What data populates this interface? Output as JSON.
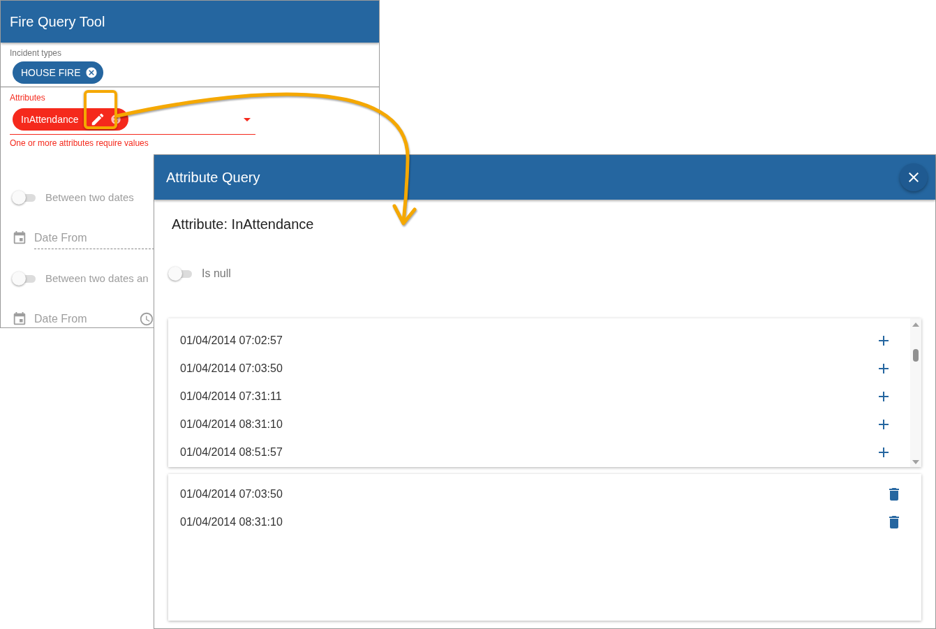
{
  "tool": {
    "title": "Fire Query Tool",
    "incident_types": {
      "label": "Incident types",
      "chips": [
        {
          "label": "HOUSE FIRE"
        }
      ]
    },
    "attributes": {
      "label": "Attributes",
      "invalid": true,
      "chips": [
        {
          "label": "InAttendance"
        }
      ],
      "error": "One or more attributes require values"
    },
    "filters": [
      {
        "kind": "toggle",
        "label": "Between two dates",
        "on": false
      },
      {
        "kind": "date",
        "placeholder": "Date From"
      },
      {
        "kind": "toggle",
        "label": "Between two dates an",
        "on": false
      },
      {
        "kind": "datetime",
        "placeholder": "Date From"
      }
    ]
  },
  "dialog": {
    "title": "Attribute Query",
    "heading": "Attribute: InAttendance",
    "is_null": {
      "label": "Is null",
      "on": false
    },
    "available_values": [
      {
        "label": "01/04/2014 07:02:57"
      },
      {
        "label": "01/04/2014 07:03:50"
      },
      {
        "label": "01/04/2014 07:31:11"
      },
      {
        "label": "01/04/2014 08:31:10"
      },
      {
        "label": "01/04/2014 08:51:57"
      }
    ],
    "selected_values": [
      {
        "label": "01/04/2014 07:03:50"
      },
      {
        "label": "01/04/2014 08:31:10"
      }
    ]
  }
}
